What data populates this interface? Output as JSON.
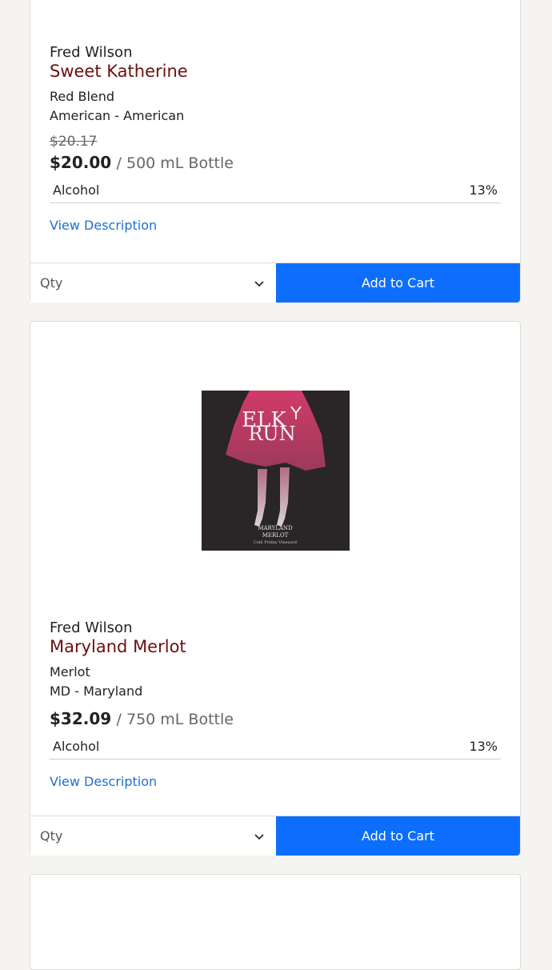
{
  "products": [
    {
      "winery": "Fred Wilson",
      "name": "Sweet Katherine",
      "varietal": "Red Blend",
      "region": "American - American",
      "old_price": "$20.17",
      "price": "$20.00",
      "size": "/ 500 mL Bottle",
      "attr_label": "Alcohol",
      "attr_value": "13%",
      "view_description": "View Description",
      "qty_label": "Qty",
      "add_to_cart": "Add to Cart"
    },
    {
      "winery": "Fred Wilson",
      "name": "Maryland Merlot",
      "varietal": "Merlot",
      "region": "MD - Maryland",
      "price": "$32.09",
      "size": "/ 750 mL Bottle",
      "attr_label": "Alcohol",
      "attr_value": "13%",
      "view_description": "View Description",
      "qty_label": "Qty",
      "add_to_cart": "Add to Cart",
      "label_image": {
        "brand_line1": "ELK",
        "brand_line2": "RUN",
        "caption_line1": "MARYLAND",
        "caption_line2": "MERLOT",
        "caption_line3": "Cold Friday Vineyard"
      }
    }
  ],
  "colors": {
    "background": "#f6f4f0",
    "wine_name": "#6b0f0f",
    "link": "#1f6fce",
    "button": "#0d6efd"
  }
}
